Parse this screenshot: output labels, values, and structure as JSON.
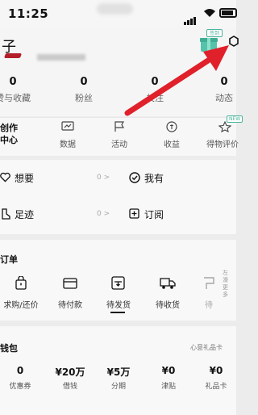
{
  "status_bar": {
    "time": "11:25"
  },
  "profile": {
    "back_glyph": "子",
    "gift_badge": "签到",
    "stats": [
      {
        "value": "0",
        "label": "赞与收藏"
      },
      {
        "value": "0",
        "label": "粉丝"
      },
      {
        "value": "0",
        "label": "关注"
      },
      {
        "value": "0",
        "label": "动态"
      }
    ]
  },
  "creator": {
    "title_line1": "创作",
    "title_line2": "中心",
    "new_badge": "NEW",
    "items": [
      {
        "label": "数据",
        "icon": "chart-icon"
      },
      {
        "label": "活动",
        "icon": "flag-icon"
      },
      {
        "label": "收益",
        "icon": "coin-icon"
      },
      {
        "label": "得物评价",
        "icon": "star-icon"
      }
    ]
  },
  "quick_links": [
    {
      "label": "想要",
      "count": "0 >",
      "icon": "heart-icon"
    },
    {
      "label": "我有",
      "icon": "check-circle-icon"
    },
    {
      "label": "足迹",
      "count": "0 >",
      "icon": "footprint-icon"
    },
    {
      "label": "订阅",
      "icon": "plus-square-icon"
    }
  ],
  "orders": {
    "title": "订单",
    "more": "左滑更多",
    "items": [
      {
        "label": "求购/还价",
        "icon": "bag-icon"
      },
      {
        "label": "待付款",
        "icon": "wallet-card-icon"
      },
      {
        "label": "待发货",
        "icon": "package-icon",
        "active": true
      },
      {
        "label": "待收货",
        "icon": "truck-icon"
      },
      {
        "label": "待",
        "icon": "return-icon"
      }
    ]
  },
  "wallet": {
    "title": "钱包",
    "gift_card_text": "心意礼品卡",
    "items": [
      {
        "value": "0",
        "label": "优惠券"
      },
      {
        "value": "¥20万",
        "label": "借钱"
      },
      {
        "value": "¥5万",
        "label": "分期"
      },
      {
        "value": "¥0",
        "label": "津贴"
      },
      {
        "value": "¥0",
        "label": "礼品卡"
      }
    ]
  },
  "colors": {
    "accent": "#4bb39b",
    "arrow": "#e0202a"
  }
}
